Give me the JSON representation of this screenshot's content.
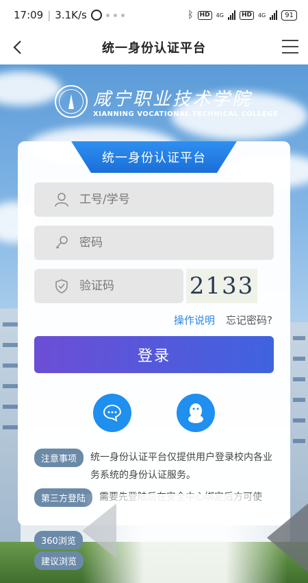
{
  "status_bar": {
    "time": "17:09",
    "speed": "3.1K/s",
    "battery": "91",
    "network_type": "4G"
  },
  "app_bar": {
    "title": "统一身份认证平台"
  },
  "college": {
    "name_cn": "咸宁职业技术学院",
    "name_en": "XIANNING VOCATIONAL TECHNICAL COLLEGE"
  },
  "card": {
    "header": "统一身份认证平台",
    "username_placeholder": "工号/学号",
    "password_placeholder": "密码",
    "captcha_placeholder": "验证码",
    "captcha_text": "2133",
    "help_link": "操作说明",
    "forgot_link": "忘记密码?",
    "login_button": "登录"
  },
  "notices": [
    {
      "badge": "注意事项",
      "text": "统一身份认证平台仅提供用户登录校内各业务系统的身份认证服务。"
    },
    {
      "badge": "第三方登陆",
      "text": "需要先登陆后在安全中心绑定后方可使"
    }
  ],
  "bottom_badges": [
    "360浏览",
    "建议浏览"
  ],
  "colors": {
    "primary": "#1f8ff0",
    "login_gradient_start": "#6c4ed6",
    "login_gradient_end": "#3f63df",
    "badge": "#6b8aa8"
  }
}
